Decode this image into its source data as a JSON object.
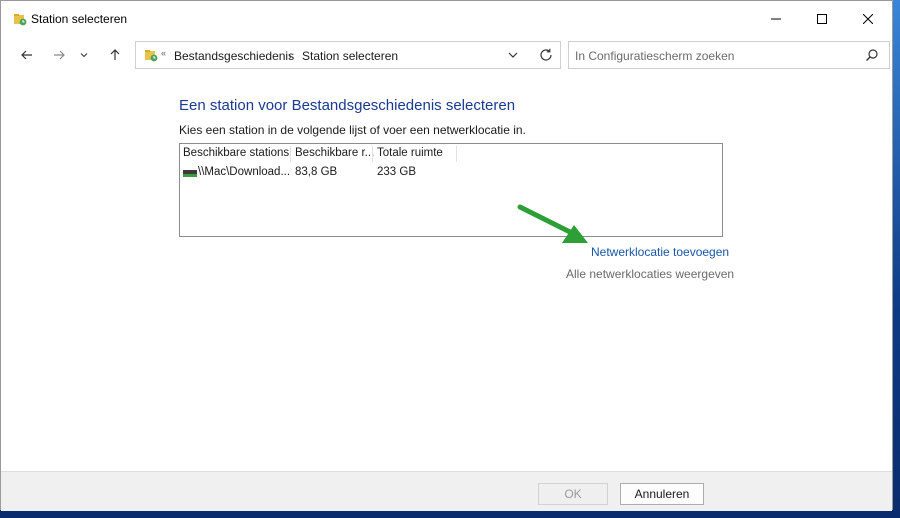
{
  "window": {
    "title": "Station selecteren"
  },
  "address_bar": {
    "small_sep": "«",
    "crumb_1": "Bestandsgeschiedenis",
    "crumb_arrow": "›",
    "crumb_2": "Station selecteren"
  },
  "search": {
    "placeholder": "In Configuratiescherm zoeken"
  },
  "content": {
    "heading": "Een station voor Bestandsgeschiedenis selecteren",
    "instruction": "Kies een station in de volgende lijst of voer een netwerklocatie in.",
    "columns": [
      "Beschikbare stations",
      "Beschikbare r...",
      "Totale ruimte"
    ],
    "rows": [
      {
        "station": "\\\\Mac\\Download...",
        "available": "83,8 GB",
        "total": "233 GB"
      }
    ],
    "link_add_network": "Netwerklocatie toevoegen",
    "link_show_all": "Alle netwerklocaties weergeven"
  },
  "footer": {
    "ok_label": "OK",
    "cancel_label": "Annuleren"
  },
  "colors": {
    "heading": "#1a3a8f",
    "link": "#1a55a8",
    "arrow": "#2e9e36"
  },
  "icons": [
    "folder-history-icon",
    "minimize-icon",
    "maximize-icon",
    "close-icon",
    "back-icon",
    "forward-icon",
    "recent-dropdown-icon",
    "up-icon",
    "chevron-down-icon",
    "refresh-icon",
    "search-icon",
    "network-drive-icon",
    "green-arrow-icon"
  ]
}
